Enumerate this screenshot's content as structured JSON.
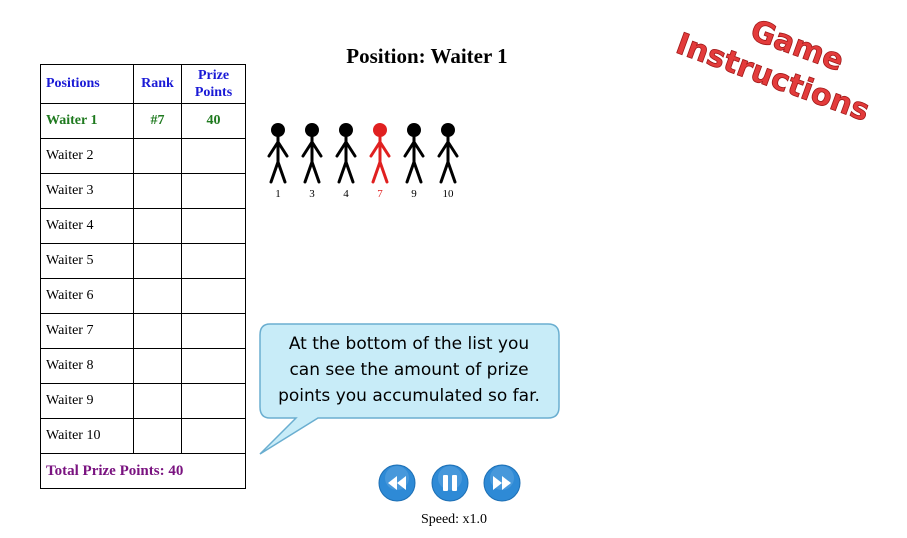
{
  "title": "Position: Waiter 1",
  "game_instructions": {
    "line1": "Game",
    "line2": "Instructions"
  },
  "table": {
    "headers": {
      "positions": "Positions",
      "rank": "Rank",
      "prize_line1": "Prize",
      "prize_line2": "Points"
    },
    "rows": [
      {
        "name": "Waiter 1",
        "rank": "#7",
        "points": "40"
      },
      {
        "name": "Waiter 2",
        "rank": "",
        "points": ""
      },
      {
        "name": "Waiter 3",
        "rank": "",
        "points": ""
      },
      {
        "name": "Waiter 4",
        "rank": "",
        "points": ""
      },
      {
        "name": "Waiter 5",
        "rank": "",
        "points": ""
      },
      {
        "name": "Waiter 6",
        "rank": "",
        "points": ""
      },
      {
        "name": "Waiter 7",
        "rank": "",
        "points": ""
      },
      {
        "name": "Waiter 8",
        "rank": "",
        "points": ""
      },
      {
        "name": "Waiter 9",
        "rank": "",
        "points": ""
      },
      {
        "name": "Waiter 10",
        "rank": "",
        "points": ""
      }
    ],
    "total_label": "Total Prize Points: 40"
  },
  "figures": {
    "labels": [
      "1",
      "3",
      "4",
      "7",
      "9",
      "10"
    ],
    "highlighted": "7",
    "highlight_color": "#e02020",
    "default_color": "#000000"
  },
  "callout": {
    "line1": "At the bottom of the list you",
    "line2": "can see the amount of prize",
    "line3": "points you accumulated so far."
  },
  "controls": {
    "rewind_icon": "rewind-icon",
    "pause_icon": "pause-icon",
    "forward_icon": "fast-forward-icon",
    "speed_label": "Speed: x1.0"
  },
  "colors": {
    "header_text": "#1a1ad6",
    "current_row": "#1f7a1f",
    "total_row": "#7a1380",
    "instructions_red": "#e33b3b",
    "button_blue": "#2e8ad6",
    "callout_fill": "#c8ecf8",
    "callout_border": "#6aaed0"
  }
}
